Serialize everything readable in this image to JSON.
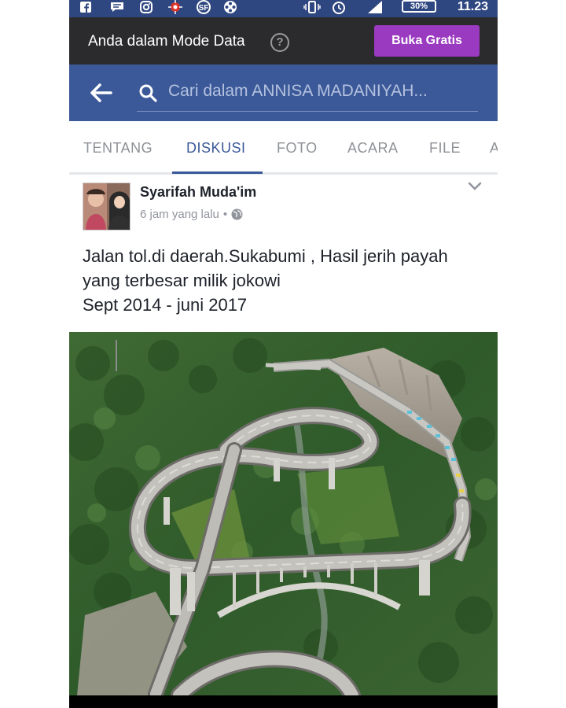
{
  "status_bar": {
    "battery": "30%",
    "time": "11.23"
  },
  "data_mode": {
    "text": "Anda dalam Mode Data",
    "help": "?",
    "button": "Buka Gratis"
  },
  "search": {
    "placeholder": "Cari dalam ANNISA MADANIYAH..."
  },
  "tabs": [
    {
      "label": "TENTANG"
    },
    {
      "label": "DISKUSI"
    },
    {
      "label": "FOTO"
    },
    {
      "label": "ACARA"
    },
    {
      "label": "FILE"
    },
    {
      "label": "A"
    }
  ],
  "post": {
    "author": "Syarifah Muda'im",
    "time": "6 jam yang lalu",
    "separator": "•",
    "text_lines": [
      "Jalan tol.di daerah.Sukabumi , Hasil jerih payah",
      "yang terbesar milik jokowi",
      "Sept 2014 - juni 2017"
    ]
  },
  "colors": {
    "facebook_blue": "#3b5998",
    "data_bar": "#2b2b2d",
    "buka_button": "#9a3ac0"
  }
}
